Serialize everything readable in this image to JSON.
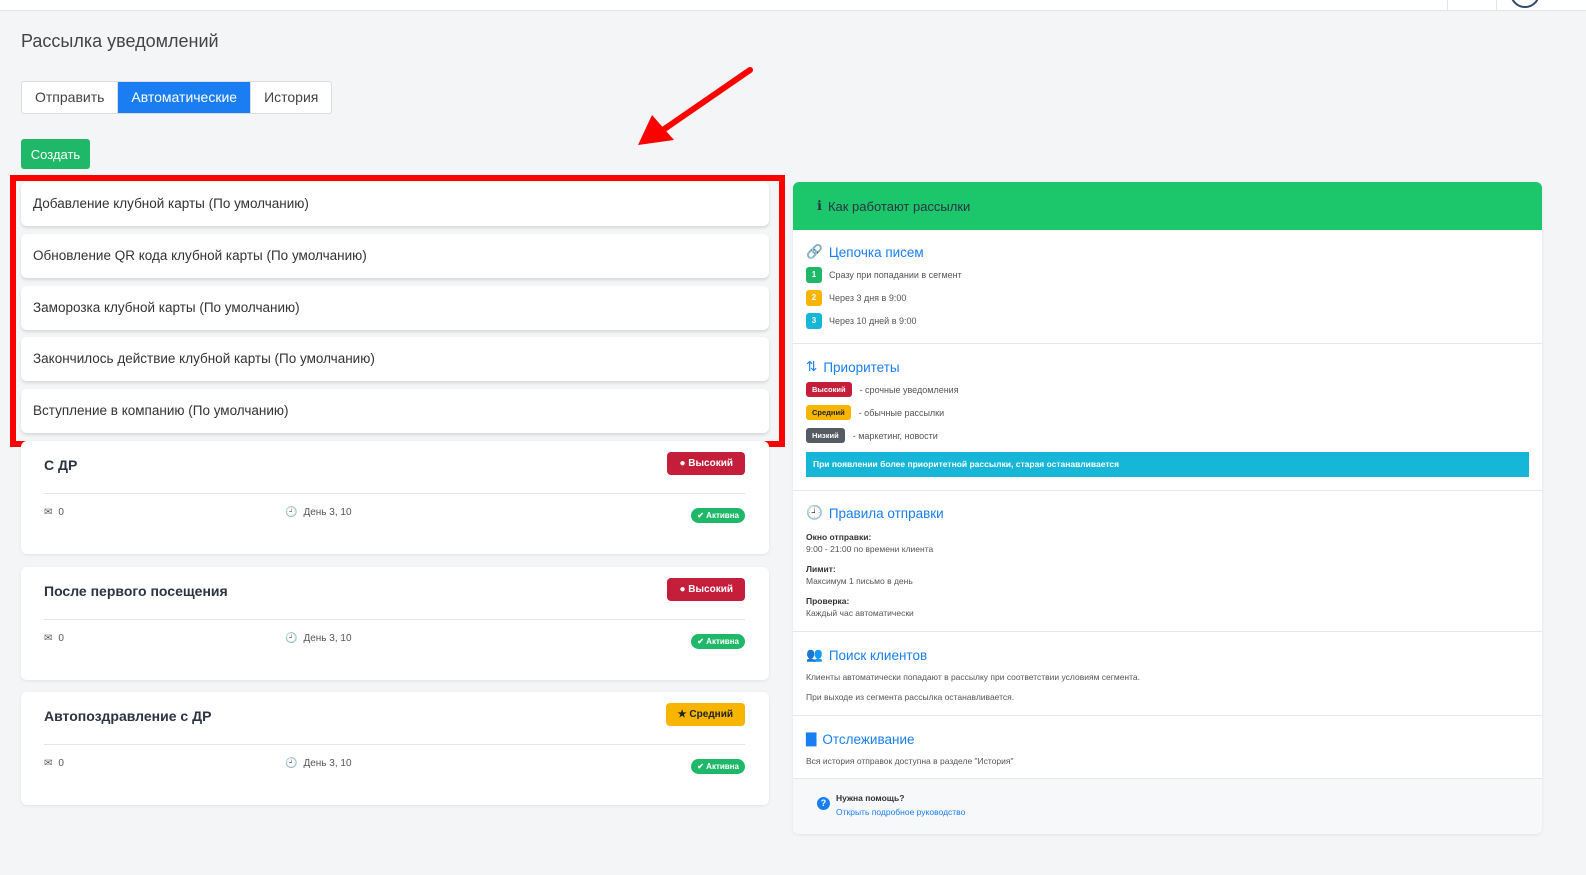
{
  "page_title": "Рассылка уведомлений",
  "tabs": [
    {
      "label": "Отправить",
      "active": false
    },
    {
      "label": "Автоматические",
      "active": true
    },
    {
      "label": "История",
      "active": false
    }
  ],
  "create_button": "Создать",
  "default_items": [
    "Добавление клубной карты (По умолчанию)",
    "Обновление QR кода клубной карты (По умолчанию)",
    "Заморозка клубной карты (По умолчанию)",
    "Закончилось действие клубной карты (По умолчанию)",
    "Вступление в компанию (По умолчанию)"
  ],
  "auto_cards": [
    {
      "title": "С ДР",
      "priority": "Высокий",
      "count": "0",
      "days": "День 3, 10",
      "status": "Активна"
    },
    {
      "title": "После первого посещения",
      "priority": "Высокий",
      "count": "0",
      "days": "День 3, 10",
      "status": "Активна"
    },
    {
      "title": "Автопоздравление с ДР",
      "priority": "Средний",
      "count": "0",
      "days": "День 3, 10",
      "status": "Активна"
    }
  ],
  "panel": {
    "header": "Как работают рассылки",
    "chain": {
      "title": "Цепочка писем",
      "steps": [
        {
          "num": "1",
          "text": "Сразу при попадании в сегмент",
          "color": "#1fb868"
        },
        {
          "num": "2",
          "text": "Через 3 дня в 9:00",
          "color": "#f7b500"
        },
        {
          "num": "3",
          "text": "Через 10 дней в 9:00",
          "color": "#15b6d8"
        }
      ]
    },
    "priorities": {
      "title": "Приоритеты",
      "items": [
        {
          "tag": "Высокий",
          "desc": "- срочные уведомления",
          "color": "#c41e3a"
        },
        {
          "tag": "Средний",
          "desc": "- обычные рассылки",
          "color": "#f7b500"
        },
        {
          "tag": "Низкий",
          "desc": "- маркетинг, новости",
          "color": "#555b63"
        }
      ],
      "note": "При появлении более приоритетной рассылки, старая останавливается"
    },
    "rules": {
      "title": "Правила отправки",
      "window_label": "Окно отправки:",
      "window_text": "9:00 - 21:00 по времени клиента",
      "limit_label": "Лимит:",
      "limit_text": "Максимум 1 письмо в день",
      "check_label": "Проверка:",
      "check_text": "Каждый час автоматически"
    },
    "search": {
      "title": "Поиск клиентов",
      "line1": "Клиенты автоматически попадают в рассылку при соответствии условиям сегмента.",
      "line2": "При выходе из сегмента рассылка останавливается."
    },
    "tracking": {
      "title": "Отслеживание",
      "text": "Вся история отправок доступна в разделе \"История\""
    },
    "help": {
      "title": "Нужна помощь?",
      "link": "Открыть подробное руководство"
    }
  },
  "colors": {
    "accent": "#1a7ef2",
    "success": "#1fb868",
    "danger": "#c41e3a",
    "warning": "#f7b500",
    "highlight": "#ff0000"
  }
}
